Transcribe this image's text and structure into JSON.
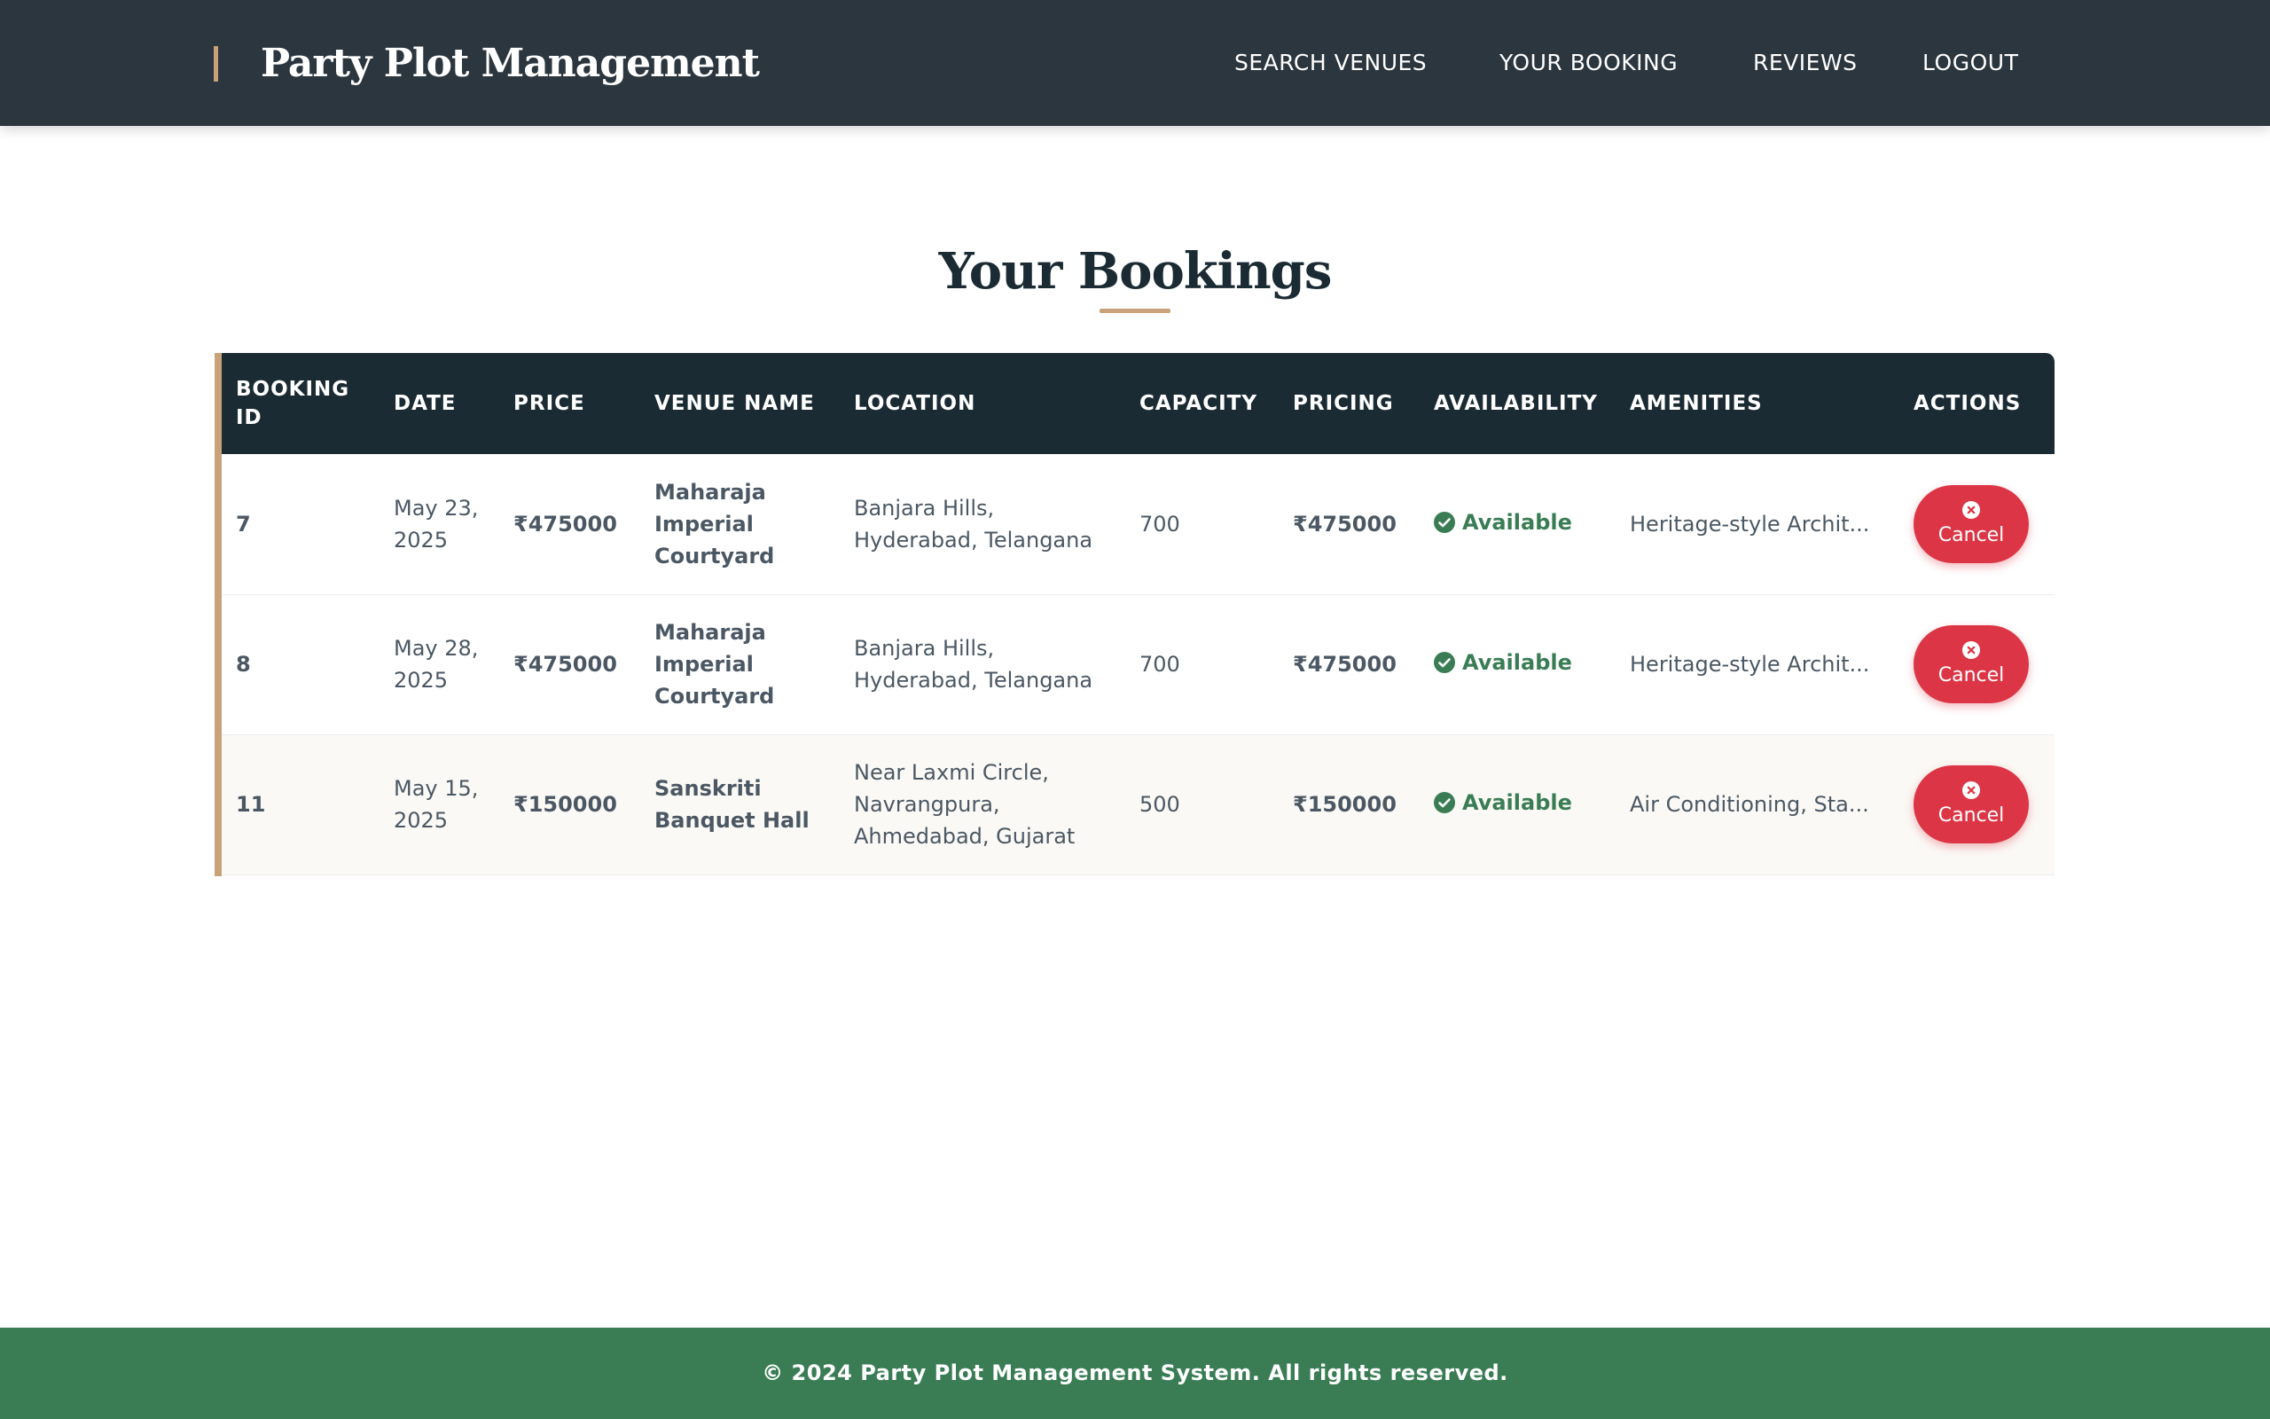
{
  "header": {
    "brand": "Party Plot Management",
    "nav": [
      {
        "label": "SEARCH VENUES"
      },
      {
        "label": "YOUR BOOKING"
      },
      {
        "label": "REVIEWS"
      },
      {
        "label": "LOGOUT"
      }
    ]
  },
  "page": {
    "title": "Your Bookings"
  },
  "table": {
    "columns": [
      "BOOKING ID",
      "DATE",
      "PRICE",
      "VENUE NAME",
      "LOCATION",
      "CAPACITY",
      "PRICING",
      "AVAILABILITY",
      "AMENITIES",
      "ACTIONS"
    ],
    "rows": [
      {
        "booking_id": "7",
        "date": "May 23, 2025",
        "price": "₹475000",
        "venue_name": "Maharaja Imperial Courtyard",
        "location": "Banjara Hills, Hyderabad, Telangana",
        "capacity": "700",
        "pricing": "₹475000",
        "availability": "Available",
        "amenities": "Heritage-style Archit...",
        "action_label": "Cancel"
      },
      {
        "booking_id": "8",
        "date": "May 28, 2025",
        "price": "₹475000",
        "venue_name": "Maharaja Imperial Courtyard",
        "location": "Banjara Hills, Hyderabad, Telangana",
        "capacity": "700",
        "pricing": "₹475000",
        "availability": "Available",
        "amenities": "Heritage-style Archit...",
        "action_label": "Cancel"
      },
      {
        "booking_id": "11",
        "date": "May 15, 2025",
        "price": "₹150000",
        "venue_name": "Sanskriti Banquet Hall",
        "location": "Near Laxmi Circle, Navrangpura, Ahmedabad, Gujarat",
        "capacity": "500",
        "pricing": "₹150000",
        "availability": "Available",
        "amenities": "Air Conditioning, Sta...",
        "action_label": "Cancel"
      }
    ]
  },
  "footer": {
    "text": "© 2024 Party Plot Management System. All rights reserved."
  },
  "icons": {
    "availability": "check-circle-icon",
    "cancel": "x-circle-icon"
  },
  "colors": {
    "navbar": "#2b363e",
    "table_header": "#1b2b34",
    "accent_gold": "#c9a27a",
    "available_green": "#3a7d55",
    "cancel_red": "#dc3545",
    "footer": "#3a7d55"
  }
}
